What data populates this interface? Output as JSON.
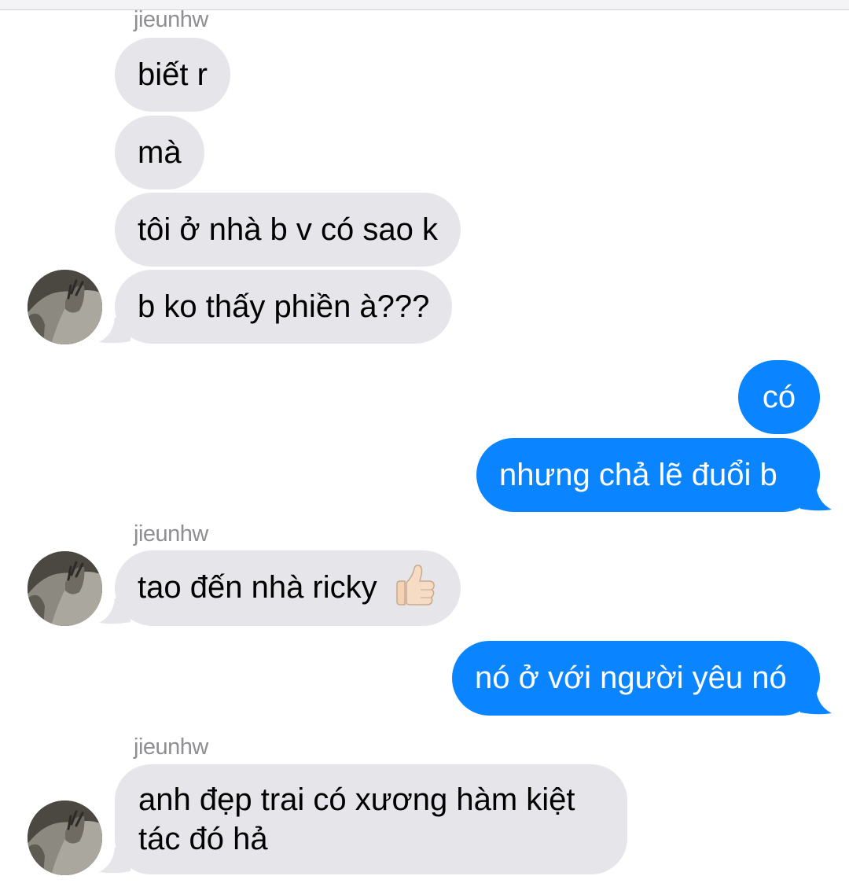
{
  "conversation": {
    "groups": [
      {
        "sender": "jieunhw",
        "messages": [
          "biết r",
          "mà",
          "tôi ở nhà b v có sao k",
          "b ko thấy phiền à???"
        ]
      },
      {
        "messages": [
          "có",
          "nhưng chả lẽ đuổi b"
        ]
      },
      {
        "sender": "jieunhw",
        "messages": [
          "tao đến nhà ricky"
        ],
        "emoji_icon": "thumbs-up-icon"
      },
      {
        "messages": [
          "nó ở với người yêu nó"
        ]
      },
      {
        "sender": "jieunhw",
        "messages": [
          "anh đẹp trai có xương hàm kiệt tác đó hả"
        ]
      }
    ]
  },
  "colors": {
    "incoming_bubble": "#e5e5ea",
    "outgoing_bubble": "#0a84ff",
    "sender_name": "#8e8e93"
  }
}
